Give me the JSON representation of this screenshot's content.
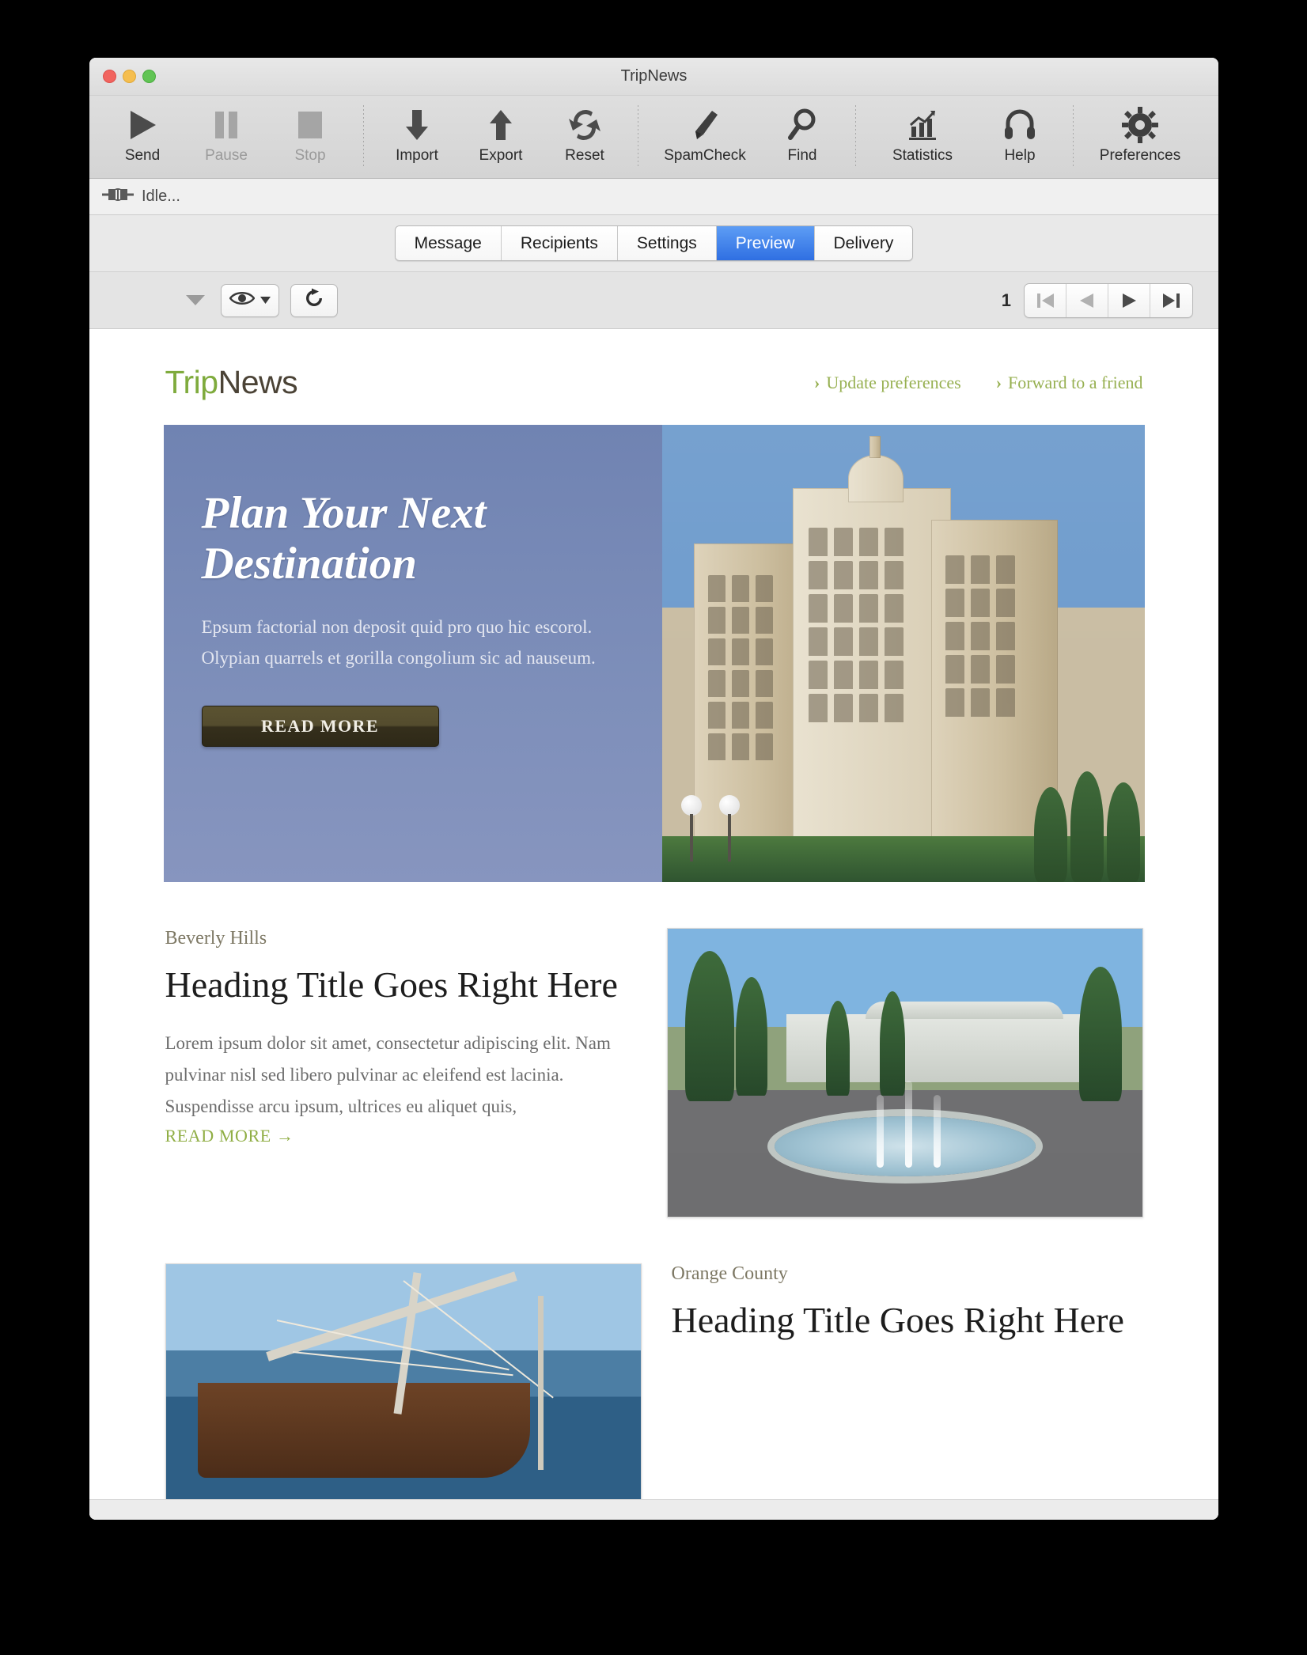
{
  "window": {
    "title": "TripNews"
  },
  "toolbar": {
    "groups": [
      {
        "items": [
          {
            "label": "Send",
            "icon": "play-icon",
            "enabled": true
          },
          {
            "label": "Pause",
            "icon": "pause-icon",
            "enabled": false
          },
          {
            "label": "Stop",
            "icon": "stop-icon",
            "enabled": false
          }
        ]
      },
      {
        "items": [
          {
            "label": "Import",
            "icon": "arrow-down-icon",
            "enabled": true
          },
          {
            "label": "Export",
            "icon": "arrow-up-icon",
            "enabled": true
          },
          {
            "label": "Reset",
            "icon": "refresh-icon",
            "enabled": true
          }
        ]
      },
      {
        "items": [
          {
            "label": "SpamCheck",
            "icon": "brush-icon",
            "enabled": true
          },
          {
            "label": "Find",
            "icon": "magnifier-icon",
            "enabled": true
          }
        ]
      },
      {
        "items": [
          {
            "label": "Statistics",
            "icon": "chart-icon",
            "enabled": true
          },
          {
            "label": "Help",
            "icon": "headset-icon",
            "enabled": true
          }
        ]
      },
      {
        "items": [
          {
            "label": "Preferences",
            "icon": "gear-icon",
            "enabled": true
          }
        ]
      }
    ]
  },
  "status": {
    "icon": "connector-icon",
    "text": "Idle..."
  },
  "tabs": {
    "items": [
      {
        "label": "Message",
        "active": false
      },
      {
        "label": "Recipients",
        "active": false
      },
      {
        "label": "Settings",
        "active": false
      },
      {
        "label": "Preview",
        "active": true
      },
      {
        "label": "Delivery",
        "active": false
      }
    ],
    "active_color": "#2f6fe2"
  },
  "preview_controls": {
    "collapse_icon": "triangle-down-icon",
    "view_icon": "eye-icon",
    "view_dropdown_icon": "chevron-down-icon",
    "reload_icon": "reload-icon",
    "page_number": "1",
    "pager": [
      {
        "name": "first",
        "icon": "skip-back-icon",
        "enabled": false
      },
      {
        "name": "prev",
        "icon": "play-back-icon",
        "enabled": false
      },
      {
        "name": "next",
        "icon": "play-icon",
        "enabled": true
      },
      {
        "name": "last",
        "icon": "skip-forward-icon",
        "enabled": true
      }
    ]
  },
  "email": {
    "logo": {
      "part_a": "Trip",
      "part_b": "News",
      "color_a": "#7fab3d",
      "color_b": "#4b4336"
    },
    "header_links": [
      {
        "chevron": "›",
        "label": "Update preferences"
      },
      {
        "chevron": "›",
        "label": "Forward to a friend"
      }
    ],
    "link_color": "#97b051",
    "hero": {
      "title": "Plan Your Next Destination",
      "body": "Epsum factorial non deposit quid pro quo hic escorol. Olypian quarrels et gorilla congolium sic ad nauseum.",
      "button_label": "READ MORE",
      "background_color": "#7e8fba",
      "button_color": "#3b3420",
      "image": "grand-hotel-building-photo"
    },
    "articles": [
      {
        "kicker": "Beverly Hills",
        "title": "Heading Title Goes Right Here",
        "body": "Lorem ipsum dolor sit amet, consectetur adipiscing elit. Nam pulvinar nisl sed libero pulvinar ac eleifend est lacinia. Suspendisse arcu ipsum, ultrices eu aliquet quis,",
        "read_more": "READ MORE  →",
        "image": "fountain-park-photo",
        "image_side": "right"
      },
      {
        "kicker": "Orange County",
        "title": "Heading Title Goes Right Here",
        "body": "",
        "read_more": "",
        "image": "sailing-ship-harbor-photo",
        "image_side": "left"
      }
    ]
  }
}
